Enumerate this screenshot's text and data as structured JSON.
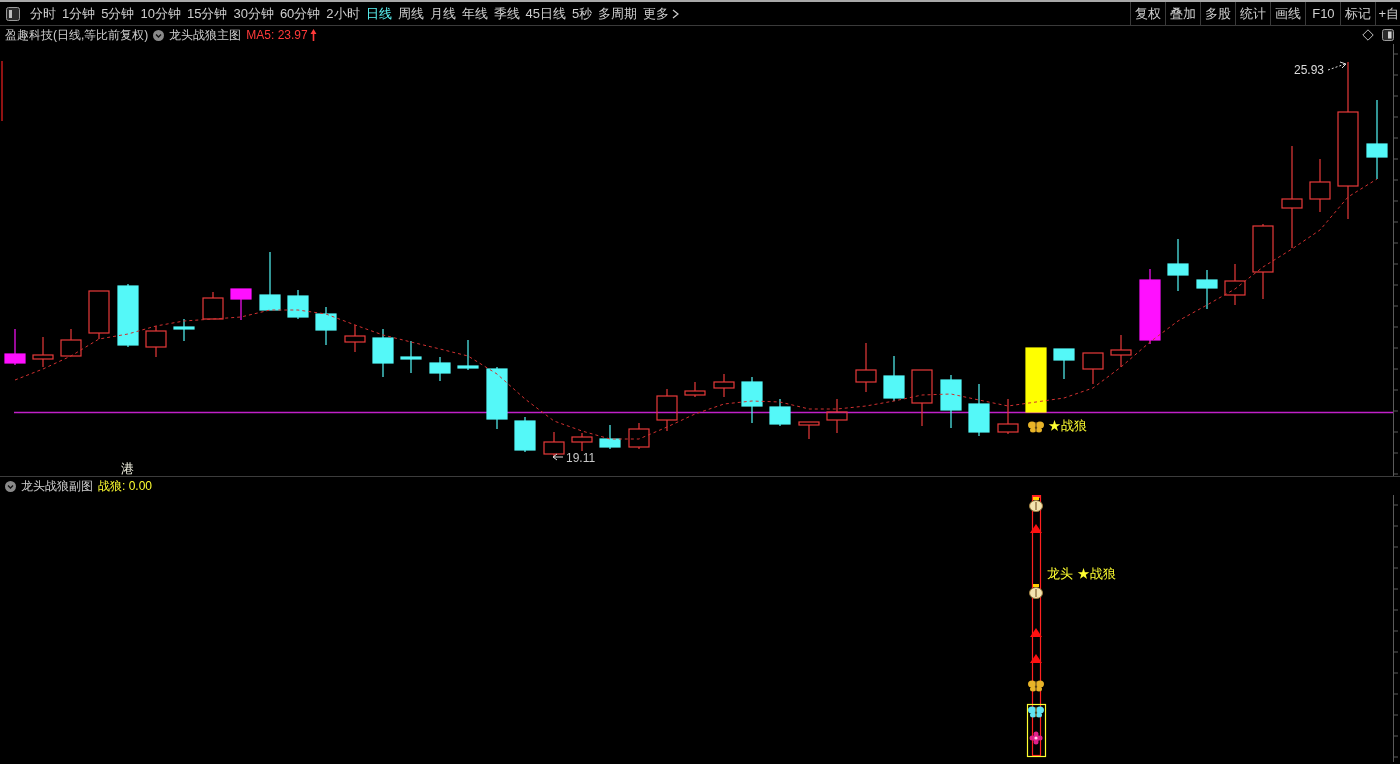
{
  "period_bar": {
    "tabs": [
      {
        "label": "分时",
        "selected": false
      },
      {
        "label": "1分钟",
        "selected": false
      },
      {
        "label": "5分钟",
        "selected": false
      },
      {
        "label": "10分钟",
        "selected": false
      },
      {
        "label": "15分钟",
        "selected": false
      },
      {
        "label": "30分钟",
        "selected": false
      },
      {
        "label": "60分钟",
        "selected": false
      },
      {
        "label": "2小时",
        "selected": false
      },
      {
        "label": "日线",
        "selected": true
      },
      {
        "label": "周线",
        "selected": false
      },
      {
        "label": "月线",
        "selected": false
      },
      {
        "label": "年线",
        "selected": false
      },
      {
        "label": "季线",
        "selected": false
      },
      {
        "label": "45日线",
        "selected": false
      },
      {
        "label": "5秒",
        "selected": false
      },
      {
        "label": "多周期",
        "selected": false
      },
      {
        "label": "更多",
        "selected": false
      }
    ],
    "tools": [
      "复权",
      "叠加",
      "多股",
      "统计",
      "画线",
      "F10",
      "标记",
      "+自"
    ]
  },
  "main_chart": {
    "title": "盈趣科技(日线,等比前复权)",
    "indicator": "龙头战狼主图",
    "ma_reading": "MA5: 23.97",
    "annotations": [
      {
        "kind": "high",
        "text": "25.93"
      },
      {
        "kind": "low",
        "text": "19.11"
      },
      {
        "kind": "note",
        "text": "港"
      },
      {
        "kind": "signal",
        "text": "★战狼"
      }
    ]
  },
  "sub_chart": {
    "indicator": "龙头战狼副图",
    "reading": "战狼: 0.00",
    "signal_text": "龙头 ★战狼"
  }
}
